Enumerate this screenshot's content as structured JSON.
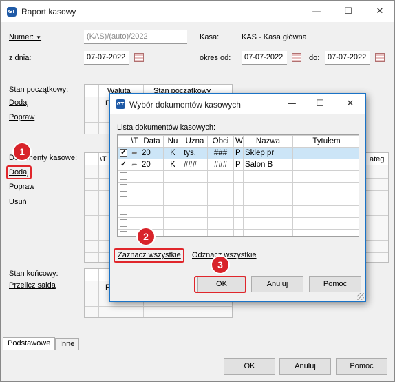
{
  "window": {
    "title": "Raport kasowy",
    "icon": "GT",
    "controls": {
      "minimize": "—",
      "maximize": "☐",
      "close": "✕"
    }
  },
  "header": {
    "number_label": "Numer:",
    "number_value": "(KAS)/(auto)/2022",
    "kasa_label": "Kasa:",
    "kasa_value": "KAS - Kasa główna",
    "date_label": "z dnia:",
    "date_value": "07-07-2022",
    "period_label": "okres od:",
    "period_from": "07-07-2022",
    "period_to_label": "do:",
    "period_to": "07-07-2022"
  },
  "opening": {
    "label": "Stan początkowy:",
    "add": "Dodaj",
    "edit": "Popraw",
    "col_currency": "Waluta",
    "col_balance": "Stan początkowy",
    "cell_p": "P"
  },
  "documents": {
    "label": "Dokumenty kasowe:",
    "add": "Dodaj",
    "edit": "Popraw",
    "delete": "Usuń",
    "col_first": "\\T",
    "col_last": "ateg"
  },
  "closing": {
    "label": "Stan końcowy:",
    "recalc": "Przelicz salda",
    "cell_p": "P"
  },
  "tabs": [
    {
      "label": "Podstawowe"
    },
    {
      "label": "Inne"
    }
  ],
  "bottom_buttons": {
    "ok": "OK",
    "cancel": "Anuluj",
    "help": "Pomoc"
  },
  "dialog": {
    "title": "Wybór dokumentów kasowych",
    "icon": "GT",
    "controls": {
      "minimize": "—",
      "maximize": "☐",
      "close": "✕"
    },
    "list_label": "Lista dokumentów kasowych:",
    "columns": [
      "\\T",
      "Data",
      "Nu",
      "Uzna",
      "Obci",
      "W",
      "Nazwa",
      "Tytułem"
    ],
    "rows": [
      {
        "checked": true,
        "data": "20",
        "nu": "K",
        "uzna": "tys.",
        "obci": "###",
        "w": "P",
        "nazwa": "Sklep pr",
        "tytulem": ""
      },
      {
        "checked": true,
        "data": "20",
        "nu": "K",
        "uzna": "###",
        "obci": "###",
        "w": "P",
        "nazwa": "Salon B",
        "tytulem": ""
      }
    ],
    "check_mark": "✓",
    "select_all": "Zaznacz wszystkie",
    "deselect_all": "Odznacz wszystkie",
    "ok": "OK",
    "cancel": "Anuluj",
    "help": "Pomoc"
  },
  "markers": {
    "m1": "1",
    "m2": "2",
    "m3": "3"
  },
  "accent_colors": {
    "annotation_red": "#e0262b",
    "selection": "#cce5f7",
    "dialog_border": "#1a73c7"
  }
}
